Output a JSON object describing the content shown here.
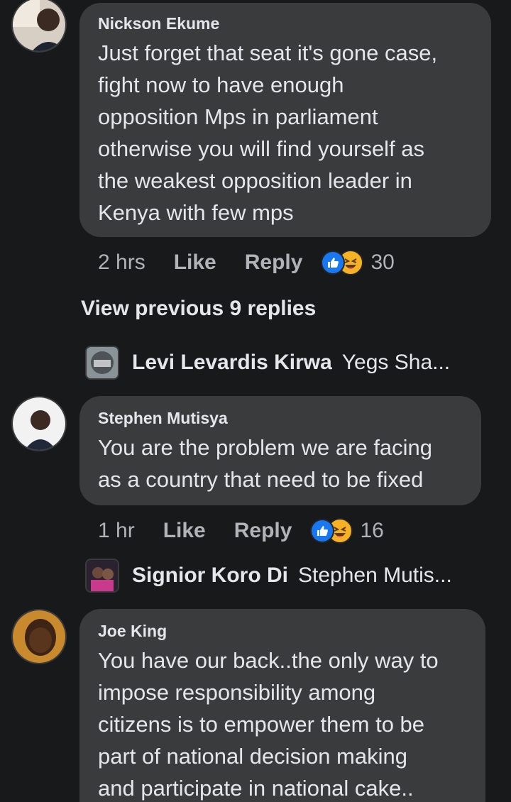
{
  "comments": [
    {
      "author": "Nickson Ekume",
      "text": "Just forget that seat it's gone case,\nfight now to have enough\nopposition Mps in parliament\notherwise you will find yourself as\nthe weakest opposition leader in\nKenya with few mps",
      "time": "2 hrs",
      "like_label": "Like",
      "reply_label": "Reply",
      "reaction_count": "30",
      "reactions": [
        "like-icon",
        "haha-icon"
      ]
    },
    {
      "author": "Stephen Mutisya",
      "text": "You are the problem we are facing\nas a country that need to be fixed",
      "time": "1 hr",
      "like_label": "Like",
      "reply_label": "Reply",
      "reaction_count": "16",
      "reactions": [
        "like-icon",
        "haha-icon"
      ]
    },
    {
      "author": "Joe King",
      "text": "You have our back..the only way to\nimpose responsibility among\ncitizens is to empower them to be\npart of national decision making\nand  participate in national cake.."
    }
  ],
  "view_previous_replies": "View previous 9 replies",
  "reply_previews": [
    {
      "name": "Levi Levardis Kirwa",
      "snippet": "Yegs Sha..."
    },
    {
      "name": "Signior Koro Di",
      "snippet": "Stephen Mutis..."
    }
  ],
  "colors": {
    "background": "#18191a",
    "bubble": "#3a3b3c",
    "text_primary": "#e4e6eb",
    "text_secondary": "#b0b3b8",
    "like_blue": "#1877f2",
    "haha_yellow": "#f7b125"
  }
}
